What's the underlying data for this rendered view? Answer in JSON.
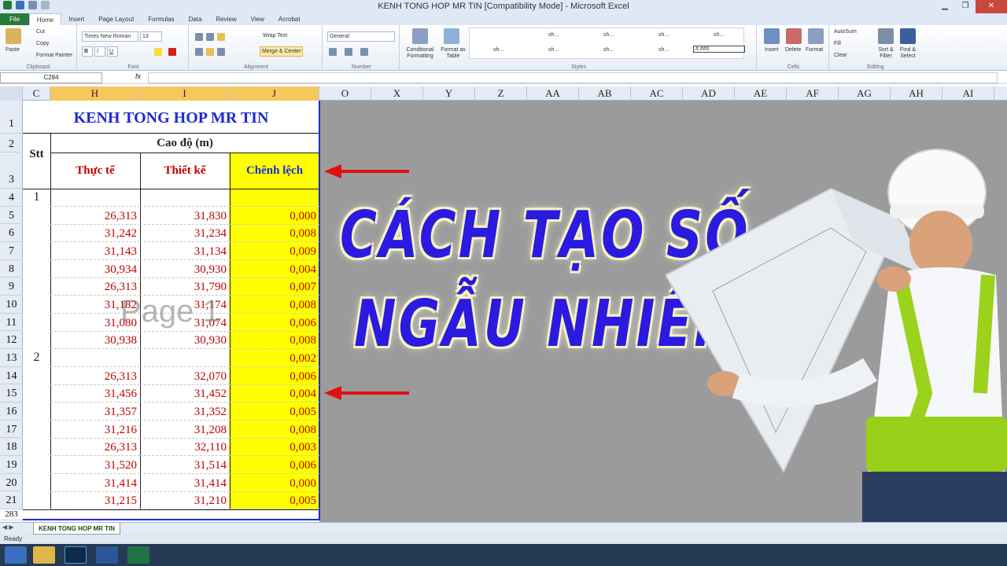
{
  "window": {
    "title": "KENH TONG HOP MR TIN  [Compatibility Mode]  -  Microsoft Excel"
  },
  "tabs": [
    "File",
    "Home",
    "Insert",
    "Page Layout",
    "Formulas",
    "Data",
    "Review",
    "View",
    "Acrobat"
  ],
  "ribbon": {
    "clipboard": {
      "paste": "Paste",
      "cut": "Cut",
      "copy": "Copy",
      "format_painter": "Format Painter",
      "label": "Clipboard"
    },
    "font": {
      "name": "Times New Roman",
      "size": "13",
      "label": "Font"
    },
    "alignment": {
      "wrap": "Wrap Text",
      "merge": "Merge & Center",
      "label": "Alignment"
    },
    "number": {
      "format": "General",
      "label": "Number"
    },
    "styles": {
      "conditional": "Conditional Formatting",
      "format_table": "Format as Table",
      "cells": [
        "sh...",
        "sh...",
        "sh...",
        "sh...",
        "sh...",
        "sh...",
        "sh...",
        "sh...",
        "#,##0"
      ],
      "label": "Styles"
    },
    "cells": {
      "insert": "Insert",
      "delete": "Delete",
      "format": "Format",
      "label": "Cells"
    },
    "editing": {
      "autosum": "AutoSum",
      "fill": "Fill",
      "clear": "Clear",
      "sort": "Sort & Filter",
      "find": "Find & Select",
      "label": "Editing"
    }
  },
  "formula_bar": {
    "name_box": "C284",
    "fx": "fx",
    "value": ""
  },
  "columns": [
    "C",
    "H",
    "I",
    "J",
    "O",
    "X",
    "Y",
    "Z",
    "AA",
    "AB",
    "AC",
    "AD",
    "AE",
    "AF",
    "AG",
    "AH",
    "AI"
  ],
  "rows": [
    "1",
    "2",
    "3",
    "4",
    "5",
    "6",
    "7",
    "8",
    "9",
    "10",
    "11",
    "12",
    "13",
    "14",
    "15",
    "16",
    "17",
    "18",
    "19",
    "20",
    "21",
    "283"
  ],
  "sheet": {
    "banner": "KENH TONG HOP MR TIN",
    "group_header": "Cao độ (m)",
    "stt": "Stt",
    "col_actual": "Thực tế",
    "col_design": "Thiết kế",
    "col_diff": "Chênh lệch",
    "watermark": "Page 1",
    "data_rows": [
      {
        "stt": "1",
        "h": "",
        "i": "",
        "j": ""
      },
      {
        "stt": "",
        "h": "26,313",
        "i": "31,830",
        "j": "0,000"
      },
      {
        "stt": "",
        "h": "31,242",
        "i": "31,234",
        "j": "0,008"
      },
      {
        "stt": "",
        "h": "31,143",
        "i": "31,134",
        "j": "0,009"
      },
      {
        "stt": "",
        "h": "30,934",
        "i": "30,930",
        "j": "0,004"
      },
      {
        "stt": "",
        "h": "26,313",
        "i": "31,790",
        "j": "0,007"
      },
      {
        "stt": "",
        "h": "31,182",
        "i": "31,174",
        "j": "0,008"
      },
      {
        "stt": "",
        "h": "31,080",
        "i": "31,074",
        "j": "0,006"
      },
      {
        "stt": "",
        "h": "30,938",
        "i": "30,930",
        "j": "0,008"
      },
      {
        "stt": "2",
        "h": "",
        "i": "",
        "j": "0,002"
      },
      {
        "stt": "",
        "h": "26,313",
        "i": "32,070",
        "j": "0,006"
      },
      {
        "stt": "",
        "h": "31,456",
        "i": "31,452",
        "j": "0,004"
      },
      {
        "stt": "",
        "h": "31,357",
        "i": "31,352",
        "j": "0,005"
      },
      {
        "stt": "",
        "h": "31,216",
        "i": "31,208",
        "j": "0,008"
      },
      {
        "stt": "",
        "h": "26,313",
        "i": "32,110",
        "j": "0,003"
      },
      {
        "stt": "",
        "h": "31,520",
        "i": "31,514",
        "j": "0,006"
      },
      {
        "stt": "",
        "h": "31,414",
        "i": "31,414",
        "j": "0,000"
      },
      {
        "stt": "",
        "h": "31,215",
        "i": "31,210",
        "j": "0,005"
      }
    ]
  },
  "overlay": {
    "line1": "CÁCH TẠO SỐ",
    "line2": "NGẪU NHIÊN"
  },
  "sheet_tab": "KENH TONG HOP MR TIN",
  "status": "Ready",
  "colors": {
    "banner_blue": "#1b2bd2",
    "value_red": "#c00000",
    "highlight_yellow": "#ffff00",
    "headline_blue": "#2b1ae0",
    "arrow_red": "#e01010"
  }
}
